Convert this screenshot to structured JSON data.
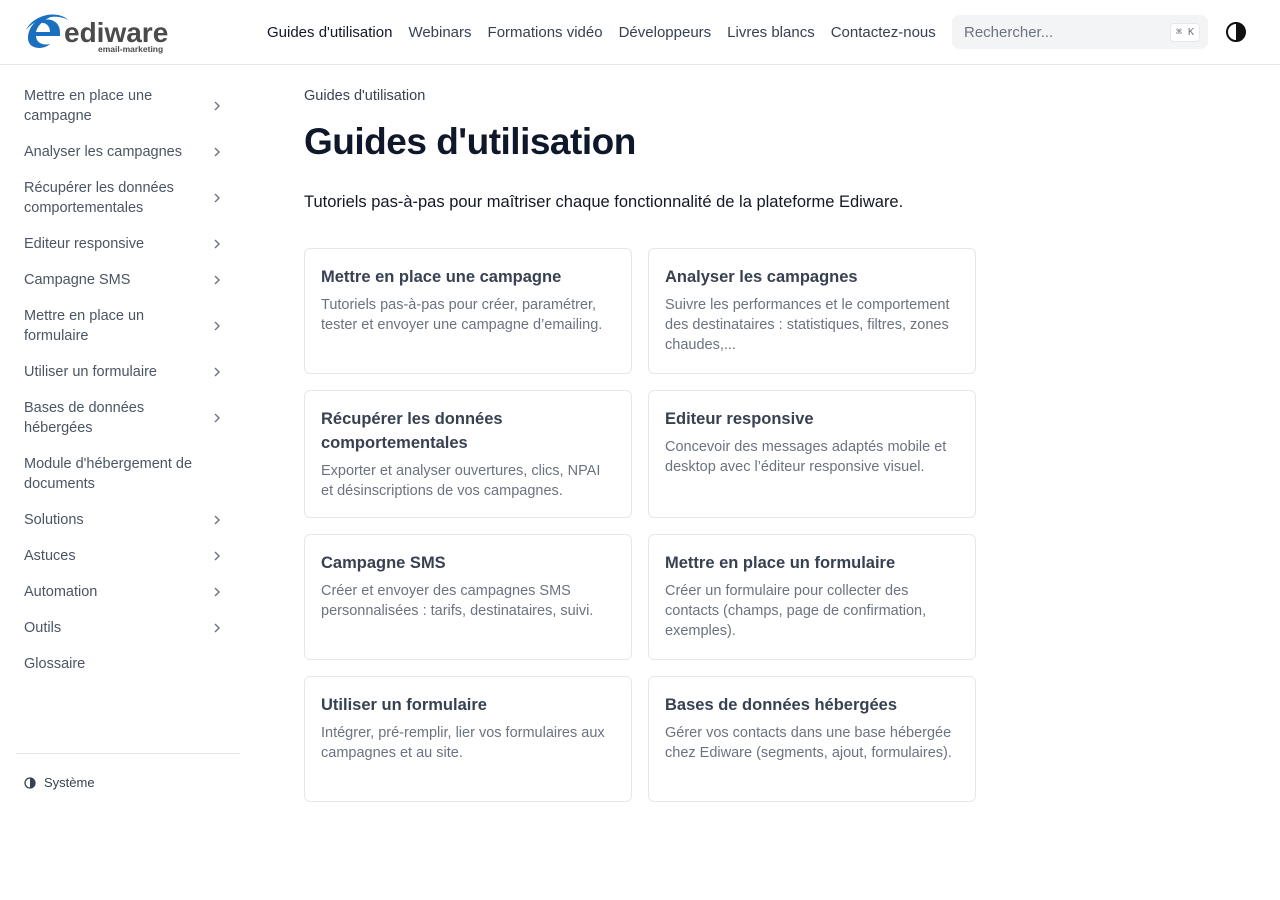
{
  "brand": {
    "logo_word": "ediware",
    "logo_tagline": "email-marketing",
    "colors": {
      "accent": "#1a6fbf",
      "text": "#4b4b4b"
    }
  },
  "nav": {
    "items": [
      {
        "label": "Guides d'utilisation",
        "active": true
      },
      {
        "label": "Webinars"
      },
      {
        "label": "Formations vidéo"
      },
      {
        "label": "Développeurs"
      },
      {
        "label": "Livres blancs"
      },
      {
        "label": "Contactez-nous"
      }
    ]
  },
  "search": {
    "placeholder": "Rechercher...",
    "shortcut": "⌘ K"
  },
  "theme_toggle": {
    "icon": "contrast-icon"
  },
  "sidebar": {
    "items": [
      {
        "label": "Mettre en place une campagne",
        "has_children": true
      },
      {
        "label": "Analyser les campagnes",
        "has_children": true
      },
      {
        "label": "Récupérer les données comportementales",
        "has_children": true
      },
      {
        "label": "Editeur responsive",
        "has_children": true
      },
      {
        "label": "Campagne SMS",
        "has_children": true
      },
      {
        "label": "Mettre en place un formulaire",
        "has_children": true
      },
      {
        "label": "Utiliser un formulaire",
        "has_children": true
      },
      {
        "label": "Bases de données hébergées",
        "has_children": true
      },
      {
        "label": "Module d'hébergement de documents",
        "has_children": false
      },
      {
        "label": "Solutions",
        "has_children": true
      },
      {
        "label": "Astuces",
        "has_children": true
      },
      {
        "label": "Automation",
        "has_children": true
      },
      {
        "label": "Outils",
        "has_children": true
      },
      {
        "label": "Glossaire",
        "has_children": false
      }
    ],
    "theme_label": "Système"
  },
  "main": {
    "breadcrumb": "Guides d'utilisation",
    "title": "Guides d'utilisation",
    "intro": "Tutoriels pas-à-pas pour maîtriser chaque fonctionnalité de la plateforme Ediware.",
    "cards": [
      {
        "title": "Mettre en place une campagne",
        "desc": "Tutoriels pas-à-pas pour créer, paramétrer, tester et envoyer une campagne d’emailing."
      },
      {
        "title": "Analyser les campagnes",
        "desc": "Suivre les performances et le comportement des destinataires : statistiques, filtres, zones chaudes,..."
      },
      {
        "title": "Récupérer les données comportementales",
        "desc": "Exporter et analyser ouvertures, clics, NPAI et désinscriptions de vos campagnes."
      },
      {
        "title": "Editeur responsive",
        "desc": "Concevoir des messages adaptés mobile et desktop avec l’éditeur responsive visuel."
      },
      {
        "title": "Campagne SMS",
        "desc": "Créer et envoyer des campagnes SMS personnalisées : tarifs, destinataires, suivi."
      },
      {
        "title": "Mettre en place un formulaire",
        "desc": "Créer un formulaire pour collecter des contacts (champs, page de confirmation, exemples)."
      },
      {
        "title": "Utiliser un formulaire",
        "desc": "Intégrer, pré-remplir, lier vos formulaires aux campagnes et au site."
      },
      {
        "title": "Bases de données hébergées",
        "desc": "Gérer vos contacts dans une base hébergée chez Ediware (segments, ajout, formulaires)."
      },
      {
        "title": "",
        "desc": ""
      },
      {
        "title": "",
        "desc": ""
      }
    ]
  }
}
